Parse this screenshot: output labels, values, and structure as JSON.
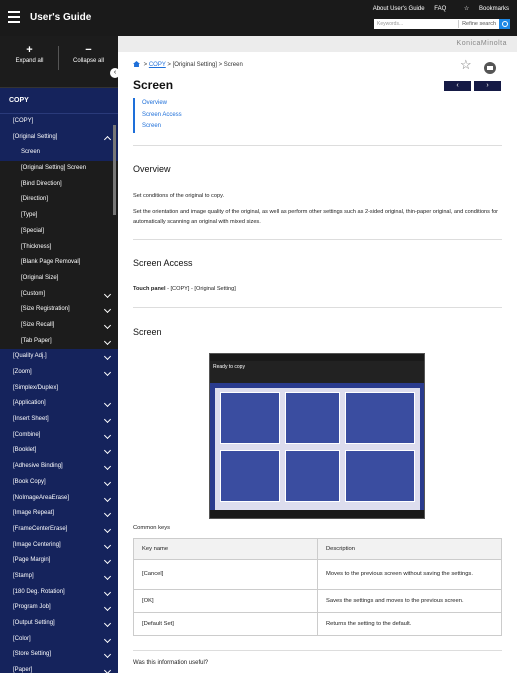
{
  "header": {
    "title": "User's Guide",
    "links": [
      "About User's Guide",
      "FAQ",
      "Bookmarks"
    ],
    "search_placeholder": "Keywords...",
    "refine": "Refine search"
  },
  "banner": {
    "logo": "KonicaMinolta"
  },
  "sidebar": {
    "expand": "Expand all",
    "collapse": "Collapse all",
    "heading": "COPY",
    "items": [
      {
        "label": "[COPY]",
        "child": false,
        "chev": ""
      },
      {
        "label": "[Original Setting]",
        "child": false,
        "chev": "up"
      },
      {
        "label": "Screen",
        "child": true,
        "chev": "",
        "sel": true
      },
      {
        "label": "[Original Setting] Screen",
        "child": true,
        "chev": ""
      },
      {
        "label": "[Bind Direction]",
        "child": true,
        "chev": ""
      },
      {
        "label": "[Direction]",
        "child": true,
        "chev": ""
      },
      {
        "label": "[Type]",
        "child": true,
        "chev": ""
      },
      {
        "label": "[Special]",
        "child": true,
        "chev": ""
      },
      {
        "label": "[Thickness]",
        "child": true,
        "chev": ""
      },
      {
        "label": "[Blank Page Removal]",
        "child": true,
        "chev": ""
      },
      {
        "label": "[Original Size]",
        "child": true,
        "chev": ""
      },
      {
        "label": "[Custom]",
        "child": true,
        "chev": "down"
      },
      {
        "label": "[Size Registration]",
        "child": true,
        "chev": "down"
      },
      {
        "label": "[Size Recall]",
        "child": true,
        "chev": "down"
      },
      {
        "label": "[Tab Paper]",
        "child": true,
        "chev": "down"
      },
      {
        "label": "[Quality Adj.]",
        "child": false,
        "chev": "down"
      },
      {
        "label": "[Zoom]",
        "child": false,
        "chev": "down"
      },
      {
        "label": "[Simplex/Duplex]",
        "child": false,
        "chev": ""
      },
      {
        "label": "[Application]",
        "child": false,
        "chev": "down"
      },
      {
        "label": "[Insert Sheet]",
        "child": false,
        "chev": "down"
      },
      {
        "label": "[Combine]",
        "child": false,
        "chev": "down"
      },
      {
        "label": "[Booklet]",
        "child": false,
        "chev": "down"
      },
      {
        "label": "[Adhesive Binding]",
        "child": false,
        "chev": "down"
      },
      {
        "label": "[Book Copy]",
        "child": false,
        "chev": "down"
      },
      {
        "label": "[NoImageAreaErase]",
        "child": false,
        "chev": "down"
      },
      {
        "label": "[Image Repeat]",
        "child": false,
        "chev": "down"
      },
      {
        "label": "[FrameCenterErase]",
        "child": false,
        "chev": "down"
      },
      {
        "label": "[Image Centering]",
        "child": false,
        "chev": "down"
      },
      {
        "label": "[Page Margin]",
        "child": false,
        "chev": "down"
      },
      {
        "label": "[Stamp]",
        "child": false,
        "chev": "down"
      },
      {
        "label": "[180 Deg. Rotation]",
        "child": false,
        "chev": "down"
      },
      {
        "label": "[Program Job]",
        "child": false,
        "chev": "down"
      },
      {
        "label": "[Output Setting]",
        "child": false,
        "chev": "down"
      },
      {
        "label": "[Color]",
        "child": false,
        "chev": "down"
      },
      {
        "label": "[Store Setting]",
        "child": false,
        "chev": "down"
      },
      {
        "label": "[Paper]",
        "child": false,
        "chev": "down"
      }
    ]
  },
  "breadcrumb": {
    "link": "COPY",
    "rest": " > [Original Setting] > Screen"
  },
  "page": {
    "title": "Screen",
    "toc": [
      "Overview",
      "Screen Access",
      "Screen"
    ],
    "overview_h": "Overview",
    "overview_p1": "Set conditions of the original to copy.",
    "overview_p2": "Set the orientation and image quality of the original, as well as perform other settings such as 2-sided original, thin-paper original, and conditions for automatically scanning an original with mixed sizes.",
    "access_h": "Screen Access",
    "access_bold": "Touch panel",
    "access_rest": " - [COPY] - [Original Setting]",
    "screen_h": "Screen",
    "screen_ready": "Ready to copy",
    "caption": "Common keys",
    "table_head": [
      "Key name",
      "Description"
    ],
    "table_rows": [
      [
        "[Cancel]",
        "Moves to the previous screen without saving the settings."
      ],
      [
        "[OK]",
        "Saves the settings and moves to the previous screen."
      ],
      [
        "[Default Set]",
        "Returns the setting to the default."
      ]
    ],
    "feedback": "Was this information useful?"
  }
}
